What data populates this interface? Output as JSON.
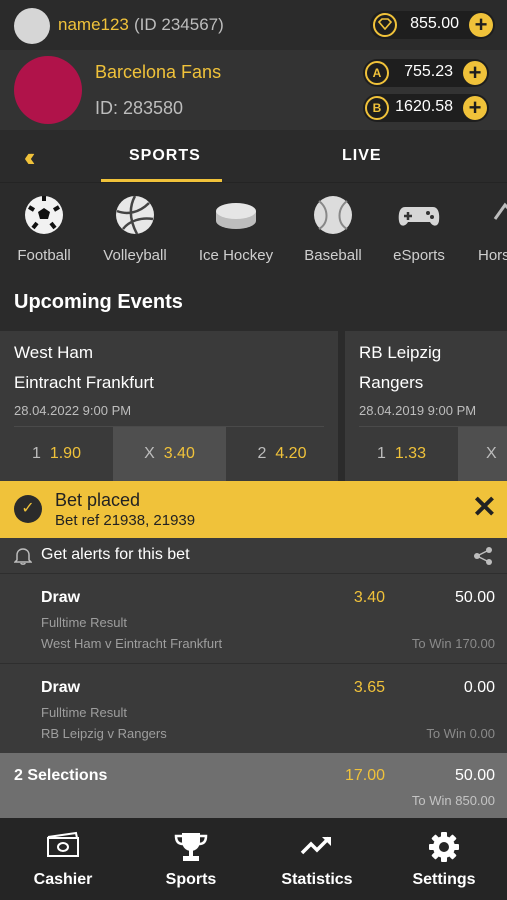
{
  "user": {
    "name": "name123",
    "id": "(ID 234567)",
    "balance": "855.00"
  },
  "club": {
    "name": "Barcelona Fans",
    "id": "ID: 283580",
    "coins_a": "755.23",
    "coins_b": "1620.58",
    "coin_a_symbol": "A",
    "coin_b_symbol": "B"
  },
  "tabs": [
    {
      "label": "SPORTS"
    },
    {
      "label": "LIVE"
    }
  ],
  "sports": [
    {
      "label": "Football",
      "icon": "football-icon"
    },
    {
      "label": "Volleyball",
      "icon": "volleyball-icon"
    },
    {
      "label": "Ice Hockey",
      "icon": "hockey-puck-icon"
    },
    {
      "label": "Baseball",
      "icon": "baseball-icon"
    },
    {
      "label": "eSports",
      "icon": "gamepad-icon"
    },
    {
      "label": "Hors",
      "icon": "horse-icon"
    }
  ],
  "upcoming_title": "Upcoming Events",
  "events": [
    {
      "home": "West Ham",
      "away": "Eintracht Frankfurt",
      "datetime": "28.04.2022  9:00 PM",
      "odds": [
        {
          "label": "1",
          "value": "1.90"
        },
        {
          "label": "X",
          "value": "3.40"
        },
        {
          "label": "2",
          "value": "4.20"
        }
      ]
    },
    {
      "home": "RB Leipzig",
      "away": "Rangers",
      "datetime": "28.04.2019  9:00 PM",
      "odds": [
        {
          "label": "1",
          "value": "1.33"
        },
        {
          "label": "X",
          "value": ""
        }
      ]
    }
  ],
  "bet_placed": {
    "title": "Bet placed",
    "ref": "Bet ref 21938, 21939"
  },
  "alerts_text": "Get alerts for this bet",
  "selections": [
    {
      "name": "Draw",
      "odds": "3.40",
      "stake": "50.00",
      "market": "Fulltime Result",
      "event": "West Ham v Eintracht Frankfurt",
      "to_win": "To Win 170.00"
    },
    {
      "name": "Draw",
      "odds": "3.65",
      "stake": "0.00",
      "market": "Fulltime Result",
      "event": "RB Leipzig v Rangers",
      "to_win": "To Win 0.00"
    }
  ],
  "total": {
    "label": "2 Selections",
    "odds": "17.00",
    "stake": "50.00",
    "to_win": "To Win 850.00"
  },
  "nav": [
    {
      "label": "Cashier",
      "icon": "cash-icon"
    },
    {
      "label": "Sports",
      "icon": "trophy-icon"
    },
    {
      "label": "Statistics",
      "icon": "trend-icon"
    },
    {
      "label": "Settings",
      "icon": "gear-icon"
    }
  ],
  "colors": {
    "accent": "#f0c23a",
    "background": "#2b2b2b",
    "club_avatar": "#b0134a"
  }
}
